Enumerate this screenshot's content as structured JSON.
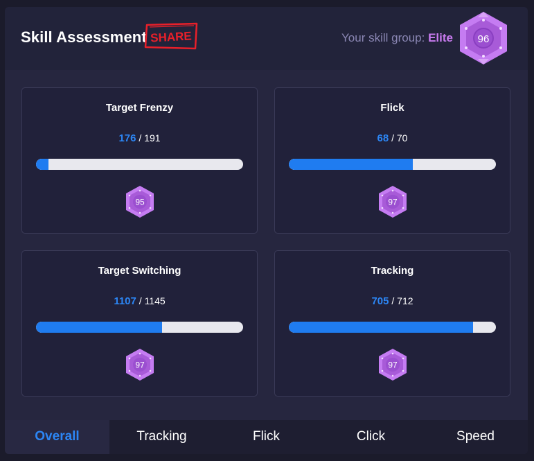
{
  "header": {
    "title": "Skill Assessment",
    "share_label": "SHARE",
    "skill_group_label": "Your skill group:",
    "skill_group_value": "Elite",
    "overall_rank": "96"
  },
  "cards": [
    {
      "title": "Target Frenzy",
      "score": "176",
      "max": "191",
      "progress": 0.06,
      "rank": "95"
    },
    {
      "title": "Flick",
      "score": "68",
      "max": "70",
      "progress": 0.6,
      "rank": "97"
    },
    {
      "title": "Target Switching",
      "score": "1107",
      "max": "1145",
      "progress": 0.61,
      "rank": "97"
    },
    {
      "title": "Tracking",
      "score": "705",
      "max": "712",
      "progress": 0.89,
      "rank": "97"
    }
  ],
  "tabs": [
    {
      "label": "Overall",
      "active": true
    },
    {
      "label": "Tracking",
      "active": false
    },
    {
      "label": "Flick",
      "active": false
    },
    {
      "label": "Click",
      "active": false
    },
    {
      "label": "Speed",
      "active": false
    }
  ],
  "colors": {
    "accent": "#2c86f5",
    "badge": "#c57cf2",
    "elite": "#c97bf0",
    "share": "#e8202a"
  }
}
